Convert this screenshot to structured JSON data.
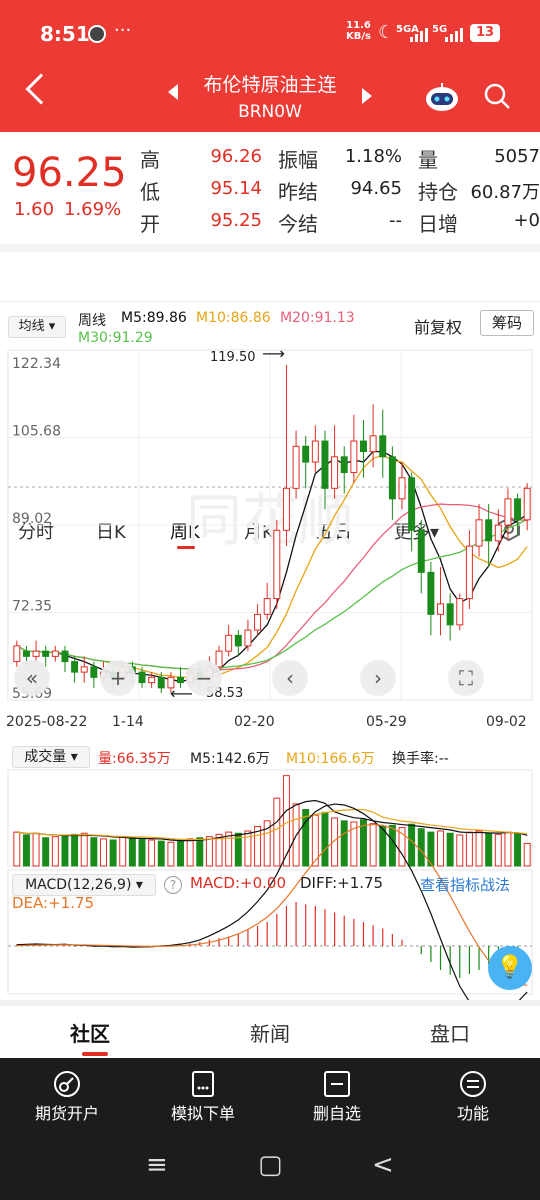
{
  "status": {
    "time": "8:51",
    "dots": "···",
    "net_speed": "11.6",
    "net_unit": "KB/s",
    "sig1": "5GA",
    "sig2": "5G",
    "battery": "13"
  },
  "header": {
    "title": "布伦特原油主连",
    "code": "BRN0W"
  },
  "quote": {
    "price": "96.25",
    "change": "1.60",
    "change_pct": "1.69%",
    "rows": [
      {
        "l1": "高",
        "v1": "96.26",
        "l2": "振幅",
        "v2": "1.18%",
        "l3": "量",
        "v3": "5057"
      },
      {
        "l1": "低",
        "v1": "95.14",
        "l2": "昨结",
        "v2": "94.65",
        "l3": "持仓",
        "v3": "60.87万"
      },
      {
        "l1": "开",
        "v1": "95.25",
        "l2": "今结",
        "v2": "--",
        "l3": "日增",
        "v3": "+0"
      }
    ]
  },
  "tabs": [
    "分时",
    "日K",
    "周K",
    "月K",
    "五日",
    "更多▾"
  ],
  "ma": {
    "selector": "均线 ▾",
    "period": "周线",
    "m5": "M5:89.86",
    "m10": "M10:86.86",
    "m20": "M20:91.13",
    "m30": "M30:91.29",
    "fq": "前复权",
    "chip": "筹码"
  },
  "colors": {
    "up": "#e02e24",
    "down": "#1a8a1a",
    "m5": "#111111",
    "m10": "#e8a417",
    "m20": "#e8607a",
    "m30": "#58c24a",
    "accent": "#ec3a35"
  },
  "chart_data": {
    "type": "candlestick",
    "y_ticks": [
      "122.34",
      "105.68",
      "89.02",
      "72.35",
      "55.69"
    ],
    "x_ticks": [
      "2025-08-22",
      "1-14",
      "02-20",
      "05-29",
      "09-02"
    ],
    "high_label": "119.50",
    "low_label": "58.53",
    "candles": [
      [
        63,
        66,
        62,
        67
      ],
      [
        65,
        64,
        62,
        66
      ],
      [
        64,
        65,
        63,
        67
      ],
      [
        65,
        64,
        62,
        66
      ],
      [
        64,
        65,
        63,
        66
      ],
      [
        65,
        63,
        61,
        66
      ],
      [
        63,
        61,
        59,
        64
      ],
      [
        61,
        62,
        59,
        64
      ],
      [
        62,
        60,
        58,
        63
      ],
      [
        60,
        61,
        59,
        63
      ],
      [
        61,
        60,
        58,
        62
      ],
      [
        60,
        62,
        59,
        63
      ],
      [
        62,
        61,
        59,
        63
      ],
      [
        61,
        59,
        58,
        62
      ],
      [
        59,
        60,
        58,
        61
      ],
      [
        60,
        58,
        57,
        61
      ],
      [
        58,
        60,
        57,
        61
      ],
      [
        60,
        59,
        58,
        62
      ],
      [
        59,
        61,
        58,
        62
      ],
      [
        61,
        60,
        58,
        63
      ],
      [
        60,
        62,
        59,
        64
      ],
      [
        62,
        65,
        61,
        66
      ],
      [
        65,
        68,
        64,
        70
      ],
      [
        68,
        66,
        64,
        69
      ],
      [
        66,
        69,
        65,
        71
      ],
      [
        69,
        72,
        68,
        74
      ],
      [
        72,
        75,
        71,
        78
      ],
      [
        75,
        88,
        73,
        90
      ],
      [
        88,
        96,
        85,
        119.5
      ],
      [
        96,
        104,
        94,
        107
      ],
      [
        104,
        101,
        96,
        106
      ],
      [
        101,
        105,
        99,
        108
      ],
      [
        105,
        96,
        92,
        107
      ],
      [
        96,
        102,
        94,
        108
      ],
      [
        102,
        99,
        95,
        104
      ],
      [
        99,
        105,
        97,
        110
      ],
      [
        105,
        103,
        98,
        109
      ],
      [
        103,
        106,
        100,
        112
      ],
      [
        106,
        102,
        98,
        111
      ],
      [
        102,
        94,
        90,
        104
      ],
      [
        94,
        98,
        92,
        101
      ],
      [
        98,
        88,
        84,
        99
      ],
      [
        88,
        80,
        76,
        90
      ],
      [
        80,
        72,
        68,
        82
      ],
      [
        72,
        74,
        68,
        81
      ],
      [
        74,
        70,
        67,
        76
      ],
      [
        70,
        75,
        69,
        76
      ],
      [
        75,
        85,
        73,
        88
      ],
      [
        85,
        90,
        83,
        93
      ],
      [
        90,
        86,
        81,
        93
      ],
      [
        86,
        89,
        84,
        92
      ],
      [
        89,
        94,
        86,
        96
      ],
      [
        94,
        90,
        87,
        95
      ],
      [
        90,
        96,
        88,
        97
      ]
    ],
    "volume": {
      "label": "成交量 ▾",
      "vol": "量:66.35万",
      "m5": "M5:142.6万",
      "m10": "M10:166.6万",
      "turnover": "换手率:--"
    },
    "volume_values": [
      60,
      55,
      58,
      50,
      52,
      54,
      56,
      58,
      50,
      48,
      46,
      52,
      50,
      48,
      46,
      44,
      42,
      45,
      48,
      50,
      52,
      56,
      60,
      58,
      62,
      70,
      80,
      120,
      160,
      110,
      100,
      90,
      95,
      85,
      80,
      78,
      82,
      75,
      70,
      72,
      68,
      74,
      66,
      60,
      62,
      58,
      55,
      60,
      62,
      58,
      56,
      60,
      58,
      40
    ],
    "macd": {
      "label": "MACD(12,26,9) ▾",
      "macd": "MACD:+0.00",
      "diff": "DIFF:+1.75",
      "dea": "DEA:+1.75",
      "link": "查看指标战法"
    },
    "macd_values": [
      0.2,
      0.1,
      0.1,
      0,
      0,
      0.1,
      -0.1,
      0,
      -0.1,
      0,
      -0.1,
      0,
      -0.1,
      0,
      0,
      0.1,
      0.1,
      0.2,
      0.3,
      0.5,
      0.8,
      1,
      1.2,
      1.5,
      2,
      2.5,
      3,
      4,
      5,
      5.5,
      5.2,
      5,
      4.6,
      4.2,
      3.8,
      3.4,
      3,
      2.6,
      2.2,
      1.5,
      0.8,
      0,
      -1,
      -2,
      -3,
      -3.6,
      -4,
      -3.5,
      -3,
      -2.4,
      -1.8,
      -1.2,
      -0.6,
      0
    ]
  },
  "tooltip_icon": "bulb-icon",
  "community_tabs": [
    "社区",
    "新闻",
    "盘口"
  ],
  "bottom_nav": [
    "期货开户",
    "模拟下单",
    "删自选",
    "功能"
  ],
  "sys_nav": [
    "≡",
    "▢",
    "<"
  ],
  "watermark": "同花顺"
}
